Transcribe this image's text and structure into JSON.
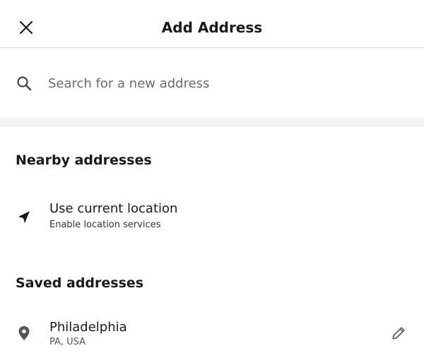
{
  "header": {
    "title": "Add Address",
    "close_icon": "close-icon"
  },
  "search": {
    "placeholder": "Search for a new address",
    "value": "",
    "icon": "search-icon"
  },
  "nearby": {
    "title": "Nearby addresses",
    "current_location": {
      "label": "Use current location",
      "sublabel": "Enable location services",
      "icon": "navigation-arrow-icon"
    }
  },
  "saved": {
    "title": "Saved addresses",
    "items": [
      {
        "name": "Philadelphia",
        "detail": "PA, USA",
        "icon": "map-pin-icon",
        "action_icon": "edit-pencil-icon"
      }
    ]
  },
  "colors": {
    "text_primary": "#1a1a1a",
    "text_secondary": "#555555",
    "divider": "#dcdcdc",
    "section_band": "#f3f3f3"
  }
}
